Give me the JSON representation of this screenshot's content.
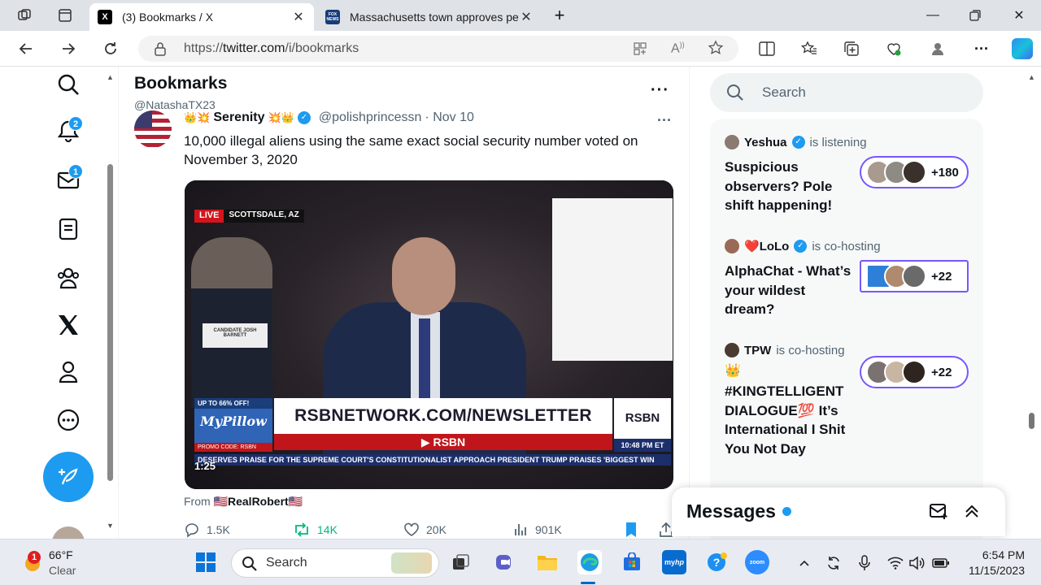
{
  "browser": {
    "tabs": [
      {
        "title": "(3) Bookmarks / X",
        "favicon": "X"
      },
      {
        "title": "Massachusetts town approves pe",
        "favicon": "FOX NEWS"
      }
    ],
    "url_prefix": "https://",
    "url_host": "twitter.com",
    "url_path": "/i/bookmarks"
  },
  "nav": {
    "notifications_badge": "2",
    "messages_badge": "1"
  },
  "header": {
    "title": "Bookmarks",
    "handle": "@NatashaTX23"
  },
  "tweet": {
    "author_name": "Serenity",
    "author_handle": "@polishprincessn",
    "date": "· Nov 10",
    "text": "10,000 illegal aliens using the same exact social security number voted on November 3, 2020",
    "video": {
      "live_label": "LIVE",
      "location": "SCOTTSDALE, AZ",
      "placard": "CANDIDATE JOSH BARNETT",
      "promo_top": "UP TO 66% OFF!",
      "promo_logo": "MyPillow",
      "promo_code": "PROMO CODE: RSBN",
      "headline": "RSBNETWORK.COM/NEWSLETTER",
      "subline": "▶ RSBN",
      "corner_logo": "RSBN",
      "corner_time": "10:48 PM ET",
      "crawl": "DESERVES PRAISE FOR THE SUPREME COURT'S CONSTITUTIONALIST APPROACH     PRESIDENT TRUMP PRAISES 'BIGGEST WIN",
      "duration": "1:25"
    },
    "from_label": "From",
    "from_name": "🇺🇸RealRobert🇺🇸",
    "replies": "1.5K",
    "reposts": "14K",
    "likes": "20K",
    "views": "901K"
  },
  "sidebar": {
    "search_placeholder": "Search",
    "spaces": [
      {
        "host": "Yeshua",
        "status": "is listening",
        "title": "Suspicious observers? Pole shift happening!",
        "count": "+180"
      },
      {
        "host": "LoLo",
        "host_prefix": "❤️",
        "status": "is co-hosting",
        "title": "AlphaChat - What’s your wildest dream?",
        "count": "+22"
      },
      {
        "host": "TPW",
        "status": "is co-hosting",
        "title_icon": "👑",
        "title": "#KINGTELLIGENT DIALOGUE💯 It’s International I Shit You Not Day",
        "count": "+22"
      }
    ]
  },
  "messages": {
    "title": "Messages"
  },
  "taskbar": {
    "temperature": "66°F",
    "condition": "Clear",
    "weather_badge": "1",
    "search_label": "Search",
    "time": "6:54 PM",
    "date": "11/15/2023"
  }
}
